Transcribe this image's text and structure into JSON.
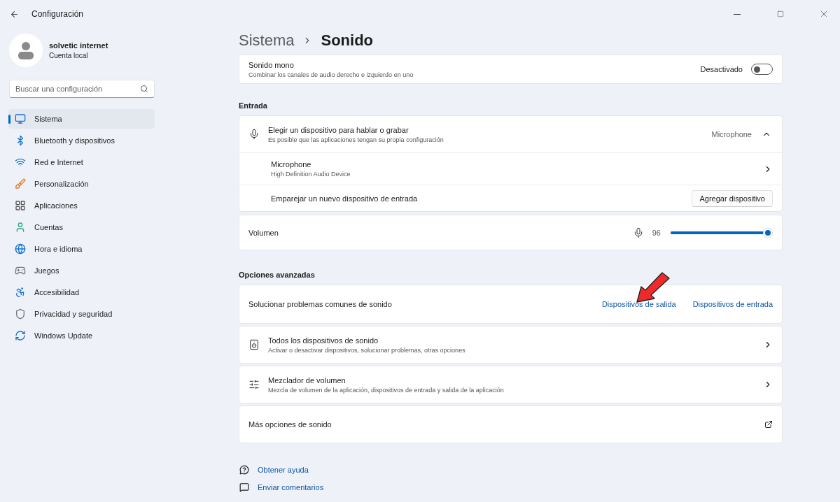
{
  "window": {
    "title": "Configuración"
  },
  "account": {
    "name": "solvetic internet",
    "type": "Cuenta local"
  },
  "search": {
    "placeholder": "Buscar una configuración"
  },
  "nav": [
    {
      "label": "Sistema",
      "selected": true
    },
    {
      "label": "Bluetooth y dispositivos",
      "selected": false
    },
    {
      "label": "Red e Internet",
      "selected": false
    },
    {
      "label": "Personalización",
      "selected": false
    },
    {
      "label": "Aplicaciones",
      "selected": false
    },
    {
      "label": "Cuentas",
      "selected": false
    },
    {
      "label": "Hora e idioma",
      "selected": false
    },
    {
      "label": "Juegos",
      "selected": false
    },
    {
      "label": "Accesibilidad",
      "selected": false
    },
    {
      "label": "Privacidad y seguridad",
      "selected": false
    },
    {
      "label": "Windows Update",
      "selected": false
    }
  ],
  "breadcrumb": [
    "Sistema",
    "Sonido"
  ],
  "mono": {
    "title": "Sonido mono",
    "description": "Combinar los canales de audio derecho e izquierdo en uno",
    "state_label": "Desactivado",
    "on": false
  },
  "input_section": {
    "heading": "Entrada",
    "device_chooser": {
      "title": "Elegir un dispositivo para hablar o grabar",
      "description": "Es posible que las aplicaciones tengan su propia configuración",
      "value": "Microphone",
      "expanded": true
    },
    "device": {
      "name": "Microphone",
      "description": "High Definition Audio Device"
    },
    "pair": {
      "label": "Emparejar un nuevo dispositivo de entrada",
      "button": "Agregar dispositivo"
    }
  },
  "volume": {
    "label": "Volumen",
    "reading": "96",
    "level": 0.96
  },
  "advanced": {
    "heading": "Opciones avanzadas",
    "troubleshoot": {
      "label": "Solucionar problemas comunes de sonido",
      "links": [
        {
          "label": "Dispositivos de salida"
        },
        {
          "label": "Dispositivos de entrada"
        }
      ],
      "annotation": {
        "kind": "arrow"
      }
    },
    "rows": [
      {
        "kind": "nav",
        "title": "Todos los dispositivos de sonido",
        "description": "Activar o desactivar dispositivos, solucionar problemas, otras opciones"
      },
      {
        "kind": "nav",
        "title": "Mezclador de volumen",
        "description": "Mezcla de volumen de la aplicación, dispositivos de entrada y salida de la aplicación"
      },
      {
        "kind": "external",
        "title": "Más opciones de sonido"
      }
    ]
  },
  "help_links": [
    "Obtener ayuda",
    "Enviar comentarios"
  ]
}
